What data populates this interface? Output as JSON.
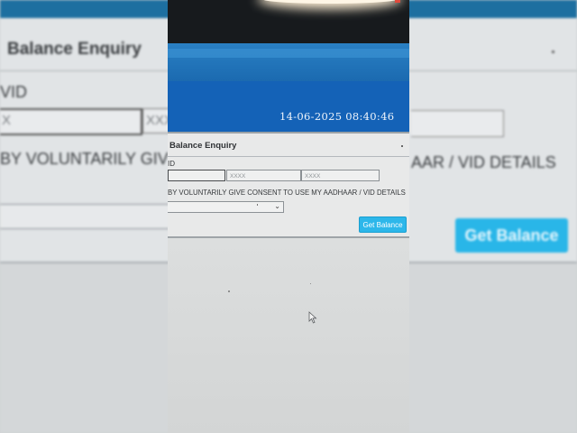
{
  "background": {
    "title": "Balance Enquiry",
    "vid_label": "VID",
    "field1": "X",
    "field2": "XXX",
    "consent_left": "BY VOLUNTARILY GIV",
    "consent_right": "AAR / VID DETAILS",
    "button": "Get Balance"
  },
  "header": {
    "datetime": "14-06-2025 08:40:46"
  },
  "panel": {
    "title": "Balance Enquiry",
    "vid_label": "ID",
    "fields": [
      {
        "placeholder": ""
      },
      {
        "placeholder": "XXXX"
      },
      {
        "placeholder": "XXXX"
      }
    ],
    "consent_text": "BY VOLUNTARILY GIVE CONSENT TO USE MY AADHAAR / VID DETAILS",
    "select_value": "",
    "button_label": "Get Balance"
  },
  "colors": {
    "header_blue": "#1462b7",
    "button_cyan": "#2db7ea",
    "screen_bg": "#e8e9e9"
  },
  "icons": {
    "dropdown": "chevron-down-icon",
    "cursor": "mouse-pointer-icon"
  }
}
